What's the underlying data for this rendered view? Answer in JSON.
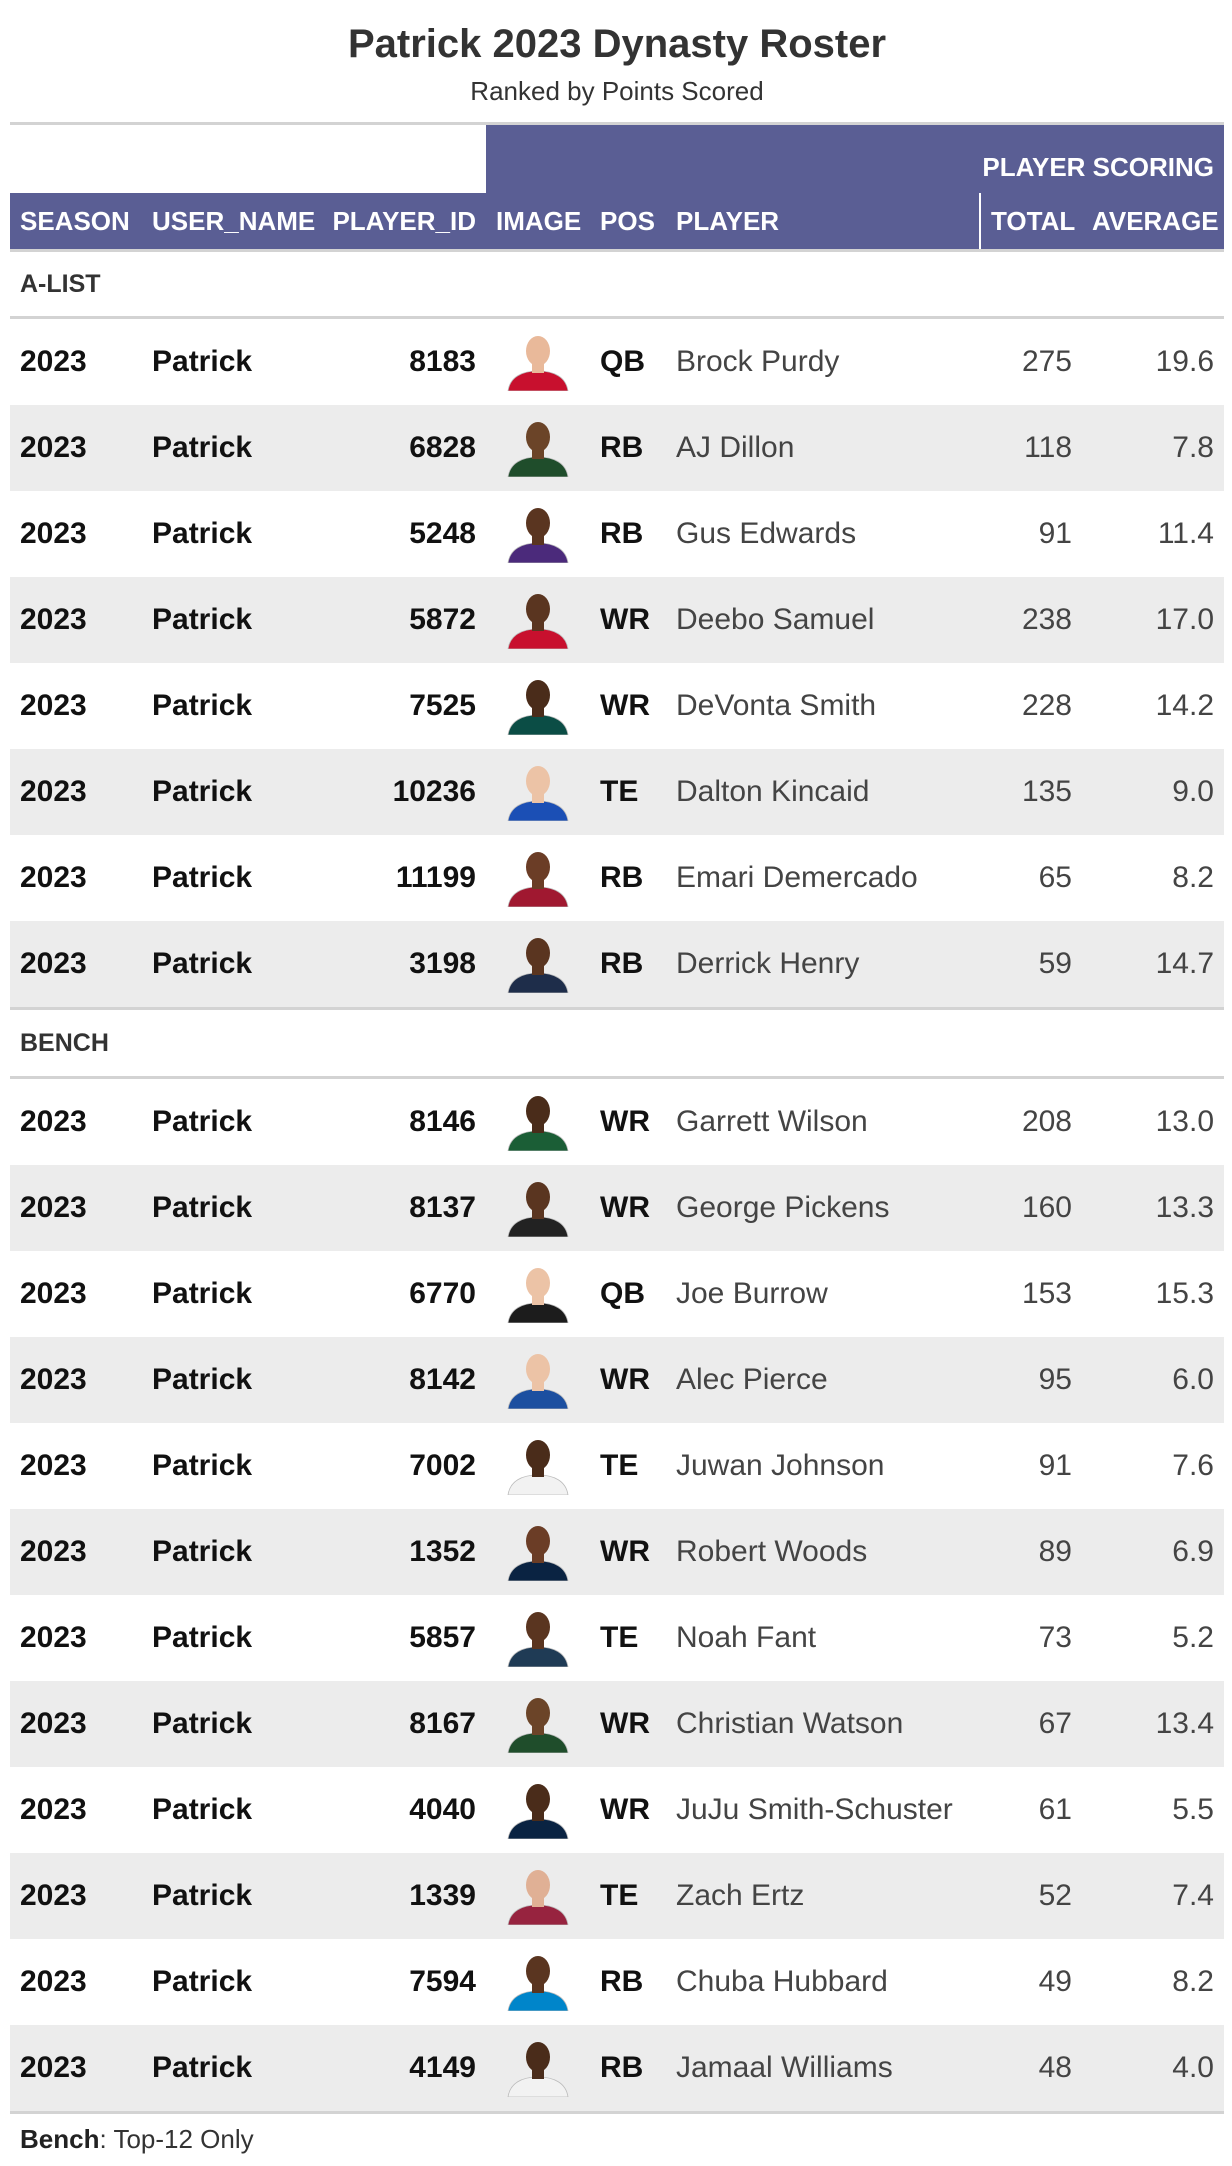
{
  "title": "Patrick 2023 Dynasty Roster",
  "subtitle": "Ranked by Points Scored",
  "spanner_label": "PLAYER SCORING",
  "columns": {
    "season": "SEASON",
    "user_name": "USER_NAME",
    "player_id": "PLAYER_ID",
    "image": "IMAGE",
    "pos": "POS",
    "player": "PLAYER",
    "total": "TOTAL",
    "average": "AVERAGE"
  },
  "groups": [
    {
      "label": "A-LIST",
      "rows": [
        {
          "season": "2023",
          "user": "Patrick",
          "player_id": "8183",
          "pos": "QB",
          "player": "Brock Purdy",
          "total": "275",
          "average": "19.6",
          "jersey": "#c8102e",
          "skin": "#e9b99a"
        },
        {
          "season": "2023",
          "user": "Patrick",
          "player_id": "6828",
          "pos": "RB",
          "player": "AJ Dillon",
          "total": "118",
          "average": "7.8",
          "jersey": "#1f4d2b",
          "skin": "#6b4428"
        },
        {
          "season": "2023",
          "user": "Patrick",
          "player_id": "5248",
          "pos": "RB",
          "player": "Gus Edwards",
          "total": "91",
          "average": "11.4",
          "jersey": "#4b2a7b",
          "skin": "#5a3520"
        },
        {
          "season": "2023",
          "user": "Patrick",
          "player_id": "5872",
          "pos": "WR",
          "player": "Deebo Samuel",
          "total": "238",
          "average": "17.0",
          "jersey": "#c8102e",
          "skin": "#5a3520"
        },
        {
          "season": "2023",
          "user": "Patrick",
          "player_id": "7525",
          "pos": "WR",
          "player": "DeVonta Smith",
          "total": "228",
          "average": "14.2",
          "jersey": "#0b4d45",
          "skin": "#4a2c1a"
        },
        {
          "season": "2023",
          "user": "Patrick",
          "player_id": "10236",
          "pos": "TE",
          "player": "Dalton Kincaid",
          "total": "135",
          "average": "9.0",
          "jersey": "#1b4fb5",
          "skin": "#ecc3a6"
        },
        {
          "season": "2023",
          "user": "Patrick",
          "player_id": "11199",
          "pos": "RB",
          "player": "Emari Demercado",
          "total": "65",
          "average": "8.2",
          "jersey": "#a01830",
          "skin": "#6b3d26"
        },
        {
          "season": "2023",
          "user": "Patrick",
          "player_id": "3198",
          "pos": "RB",
          "player": "Derrick Henry",
          "total": "59",
          "average": "14.7",
          "jersey": "#1e2d4a",
          "skin": "#5a3520"
        }
      ]
    },
    {
      "label": "BENCH",
      "rows": [
        {
          "season": "2023",
          "user": "Patrick",
          "player_id": "8146",
          "pos": "WR",
          "player": "Garrett Wilson",
          "total": "208",
          "average": "13.0",
          "jersey": "#1b5e36",
          "skin": "#4a2c1a"
        },
        {
          "season": "2023",
          "user": "Patrick",
          "player_id": "8137",
          "pos": "WR",
          "player": "George Pickens",
          "total": "160",
          "average": "13.3",
          "jersey": "#222222",
          "skin": "#5a3520"
        },
        {
          "season": "2023",
          "user": "Patrick",
          "player_id": "6770",
          "pos": "QB",
          "player": "Joe Burrow",
          "total": "153",
          "average": "15.3",
          "jersey": "#1c1c1c",
          "skin": "#ecc3a6"
        },
        {
          "season": "2023",
          "user": "Patrick",
          "player_id": "8142",
          "pos": "WR",
          "player": "Alec Pierce",
          "total": "95",
          "average": "6.0",
          "jersey": "#1c4fa0",
          "skin": "#ecc3a6"
        },
        {
          "season": "2023",
          "user": "Patrick",
          "player_id": "7002",
          "pos": "TE",
          "player": "Juwan Johnson",
          "total": "91",
          "average": "7.6",
          "jersey": "#f2f2f2",
          "skin": "#4a2c1a"
        },
        {
          "season": "2023",
          "user": "Patrick",
          "player_id": "1352",
          "pos": "WR",
          "player": "Robert Woods",
          "total": "89",
          "average": "6.9",
          "jersey": "#0a2342",
          "skin": "#6b3d26"
        },
        {
          "season": "2023",
          "user": "Patrick",
          "player_id": "5857",
          "pos": "TE",
          "player": "Noah Fant",
          "total": "73",
          "average": "5.2",
          "jersey": "#1f3b55",
          "skin": "#5a3520"
        },
        {
          "season": "2023",
          "user": "Patrick",
          "player_id": "8167",
          "pos": "WR",
          "player": "Christian Watson",
          "total": "67",
          "average": "13.4",
          "jersey": "#1f4d2b",
          "skin": "#6b4428"
        },
        {
          "season": "2023",
          "user": "Patrick",
          "player_id": "4040",
          "pos": "WR",
          "player": "JuJu Smith-Schuster",
          "total": "61",
          "average": "5.5",
          "jersey": "#0a2342",
          "skin": "#4a2c1a"
        },
        {
          "season": "2023",
          "user": "Patrick",
          "player_id": "1339",
          "pos": "TE",
          "player": "Zach Ertz",
          "total": "52",
          "average": "7.4",
          "jersey": "#97233f",
          "skin": "#e0b095"
        },
        {
          "season": "2023",
          "user": "Patrick",
          "player_id": "7594",
          "pos": "RB",
          "player": "Chuba Hubbard",
          "total": "49",
          "average": "8.2",
          "jersey": "#0085ca",
          "skin": "#5a3520"
        },
        {
          "season": "2023",
          "user": "Patrick",
          "player_id": "4149",
          "pos": "RB",
          "player": "Jamaal Williams",
          "total": "48",
          "average": "4.0",
          "jersey": "#f2f2f2",
          "skin": "#4a2c1a"
        }
      ]
    }
  ],
  "footnote": {
    "bold": "Bench",
    "text": ": Top-12 Only"
  },
  "colors": {
    "header_bg": "#5a5e94",
    "stripe": "#ececec",
    "rule": "#d3d3d3"
  }
}
